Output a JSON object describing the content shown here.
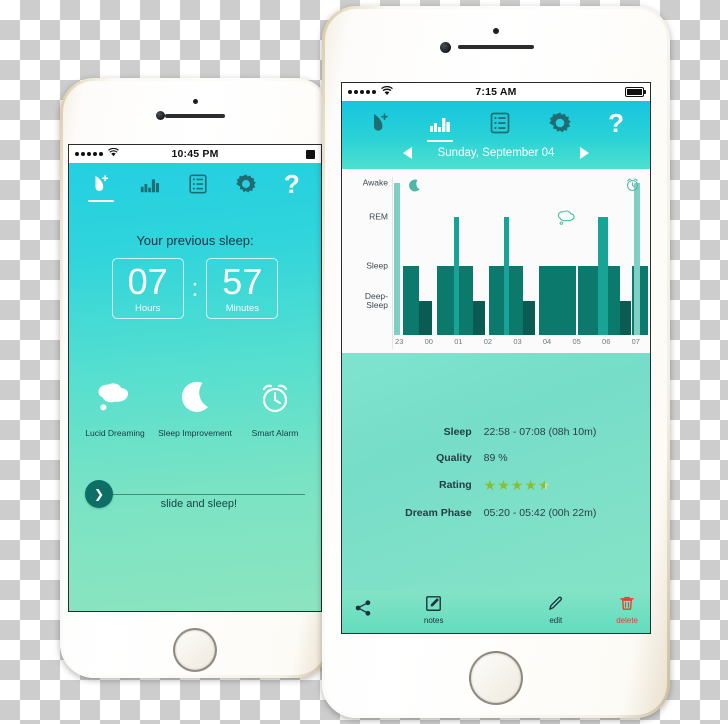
{
  "left_phone": {
    "status": {
      "time": "10:45 PM",
      "signal_dots": 5,
      "wifi": "wifi-icon"
    },
    "nav": [
      {
        "name": "sleep-tab",
        "icon": "leaf-plus-icon",
        "active": true
      },
      {
        "name": "stats-tab",
        "icon": "bar-chart-icon",
        "active": false
      },
      {
        "name": "list-tab",
        "icon": "list-icon",
        "active": false
      },
      {
        "name": "settings-tab",
        "icon": "gear-icon",
        "active": false
      },
      {
        "name": "help-tab",
        "icon": "question-mark-icon",
        "active": false
      }
    ],
    "title": "Your previous sleep:",
    "clock": {
      "hours": "07",
      "separator": ":",
      "minutes": "57",
      "hours_label": "Hours",
      "minutes_label": "Minutes"
    },
    "features": [
      {
        "icon": "thought-cloud-icon",
        "label": "Lucid Dreaming"
      },
      {
        "icon": "moon-icon",
        "label": "Sleep Improvement"
      },
      {
        "icon": "alarm-clock-icon",
        "label": "Smart Alarm"
      }
    ],
    "slider": {
      "knob_icon": "chevron-right-icon",
      "label": "slide and sleep!"
    }
  },
  "right_phone": {
    "status": {
      "time": "7:15 AM",
      "signal_dots": 5,
      "wifi": "wifi-icon"
    },
    "nav": [
      {
        "name": "sleep-tab",
        "icon": "leaf-plus-icon",
        "active": false
      },
      {
        "name": "stats-tab",
        "icon": "bar-chart-icon",
        "active": true
      },
      {
        "name": "list-tab",
        "icon": "list-icon",
        "active": false
      },
      {
        "name": "settings-tab",
        "icon": "gear-icon",
        "active": false
      },
      {
        "name": "help-tab",
        "icon": "question-mark-icon",
        "active": false
      }
    ],
    "datebar": {
      "prev": "prev-arrow",
      "date": "Sunday, September 04",
      "next": "next-arrow"
    },
    "details": [
      {
        "label": "Sleep",
        "value": "22:58 - 07:08  (08h 10m)"
      },
      {
        "label": "Quality",
        "value": "89 %"
      },
      {
        "label": "Rating",
        "value": "4.5",
        "type": "stars",
        "stars_full": 4,
        "stars_half": 1,
        "stars_total": 5
      },
      {
        "label": "Dream Phase",
        "value": "05:20 - 05:42  (00h 22m)"
      }
    ],
    "toolbar": [
      {
        "name": "share-button",
        "icon": "share-icon",
        "label": ""
      },
      {
        "name": "notes-button",
        "icon": "note-edit-icon",
        "label": "notes"
      },
      {
        "name": "edit-button",
        "icon": "pencil-icon",
        "label": "edit"
      },
      {
        "name": "delete-button",
        "icon": "trash-icon",
        "label": "delete"
      }
    ]
  },
  "chart_data": {
    "type": "bar",
    "title": "",
    "xlabel": "",
    "ylabel": "",
    "grid": false,
    "legend": null,
    "y_categories": [
      "Awake",
      "REM",
      "Sleep",
      "Deep-Sleep"
    ],
    "y_levels": {
      "Awake": 4,
      "REM": 3,
      "Sleep": 2,
      "Deep-Sleep": 1
    },
    "x_ticks": [
      "23",
      "00",
      "01",
      "02",
      "03",
      "04",
      "05",
      "06",
      "07"
    ],
    "annotations": [
      {
        "icon": "moon-icon",
        "label": "fell asleep",
        "x": 0.06
      },
      {
        "icon": "thought-cloud-icon",
        "label": "dream phase",
        "x": 0.66
      },
      {
        "icon": "alarm-clock-icon",
        "label": "alarm",
        "x": 0.93
      }
    ],
    "colors": {
      "awake": "#7fcfc5",
      "rem": "#17a395",
      "sleep": "#0b7a6d",
      "deep": "#0a5c53"
    },
    "bars": [
      {
        "x": 0.5,
        "w": 2.2,
        "level": "Awake",
        "color": "awake"
      },
      {
        "x": 4.0,
        "w": 6.5,
        "level": "Sleep",
        "color": "sleep"
      },
      {
        "x": 10.5,
        "w": 5.0,
        "level": "Deep-Sleep",
        "color": "deep"
      },
      {
        "x": 17.5,
        "w": 7.0,
        "level": "Sleep",
        "color": "sleep"
      },
      {
        "x": 24.5,
        "w": 2.0,
        "level": "REM",
        "color": "rem"
      },
      {
        "x": 26.5,
        "w": 5.5,
        "level": "Sleep",
        "color": "sleep"
      },
      {
        "x": 32.0,
        "w": 5.0,
        "level": "Deep-Sleep",
        "color": "deep"
      },
      {
        "x": 38.5,
        "w": 6.0,
        "level": "Sleep",
        "color": "sleep"
      },
      {
        "x": 44.5,
        "w": 2.2,
        "level": "REM",
        "color": "rem"
      },
      {
        "x": 46.7,
        "w": 5.5,
        "level": "Sleep",
        "color": "sleep"
      },
      {
        "x": 52.2,
        "w": 5.0,
        "level": "Deep-Sleep",
        "color": "deep"
      },
      {
        "x": 58.5,
        "w": 15.0,
        "level": "Sleep",
        "color": "sleep"
      },
      {
        "x": 74.2,
        "w": 8.0,
        "level": "Sleep",
        "color": "sleep"
      },
      {
        "x": 82.2,
        "w": 4.0,
        "level": "REM",
        "color": "rem"
      },
      {
        "x": 86.2,
        "w": 5.0,
        "level": "Sleep",
        "color": "sleep"
      },
      {
        "x": 91.2,
        "w": 4.5,
        "level": "Deep-Sleep",
        "color": "deep"
      },
      {
        "x": 96.0,
        "w": 6.5,
        "level": "Sleep",
        "color": "sleep"
      },
      {
        "x": 96.8,
        "w": 2.2,
        "level": "Awake",
        "color": "awake"
      }
    ]
  }
}
